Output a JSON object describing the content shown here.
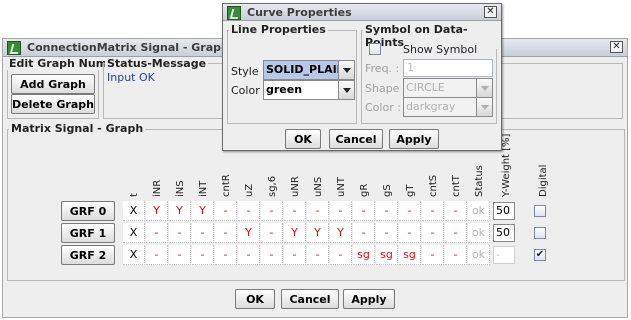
{
  "main_window": {
    "title": "ConnectionMatrix Signal - Graph",
    "edit_group_title": "Edit Graph Number",
    "add_graph": "Add Graph",
    "delete_graph": "Delete Graph",
    "status_group_title": "Status-Message",
    "status_text": "Input OK",
    "matrix_group_title": "Matrix Signal - Graph",
    "columns": [
      "t",
      "iNR",
      "iNS",
      "iNT",
      "cntR",
      "uZ",
      "sg,6",
      "uNR",
      "uNS",
      "uNT",
      "gR",
      "gS",
      "gT",
      "cntS",
      "cntT",
      "Status",
      "Y-Weight [%]",
      "Digital"
    ],
    "rows": [
      {
        "label": "GRF 0",
        "cells": [
          "X",
          "Y",
          "Y",
          "Y",
          "-",
          "-",
          "-",
          "-",
          "-",
          "-",
          "-",
          "-",
          "-",
          "-",
          "-"
        ],
        "status": "ok",
        "yweight": "50",
        "digital_checked": false
      },
      {
        "label": "GRF 1",
        "cells": [
          "X",
          "-",
          "-",
          "-",
          "-",
          "Y",
          "-",
          "Y",
          "Y",
          "Y",
          "-",
          "-",
          "-",
          "-",
          "-"
        ],
        "status": "ok",
        "yweight": "50",
        "digital_checked": false
      },
      {
        "label": "GRF 2",
        "cells": [
          "X",
          "-",
          "-",
          "-",
          "-",
          "-",
          "-",
          "-",
          "-",
          "-",
          "sg",
          "sg",
          "sg",
          "-",
          "-"
        ],
        "status": "ok",
        "yweight": "-",
        "digital_checked": true
      }
    ],
    "ok": "OK",
    "cancel": "Cancel",
    "apply": "Apply"
  },
  "dialog": {
    "title": "Curve Properties",
    "line_group_title": "Line Properties",
    "style_label": "Style :",
    "style_value": "SOLID_PLAIN",
    "color_label": "Color :",
    "color_value": "green",
    "symbol_group_title": "Symbol on Data-Points",
    "show_symbol_label": "Show Symbol",
    "freq_label": "Freq. :",
    "freq_value": "1",
    "shape_label": "Shape :",
    "shape_value": "CIRCLE",
    "symcolor_label": "Color :",
    "symcolor_value": "darkgray",
    "ok": "OK",
    "cancel": "Cancel",
    "apply": "Apply"
  },
  "icons": {
    "app": "app-logo-icon",
    "close": "close-icon",
    "dropdown": "chevron-down-icon",
    "check": "checkmark-icon"
  },
  "colors": {
    "accent": "#2244aa",
    "active_mark": "#dd1111",
    "disabled": "#b8b8b8"
  }
}
